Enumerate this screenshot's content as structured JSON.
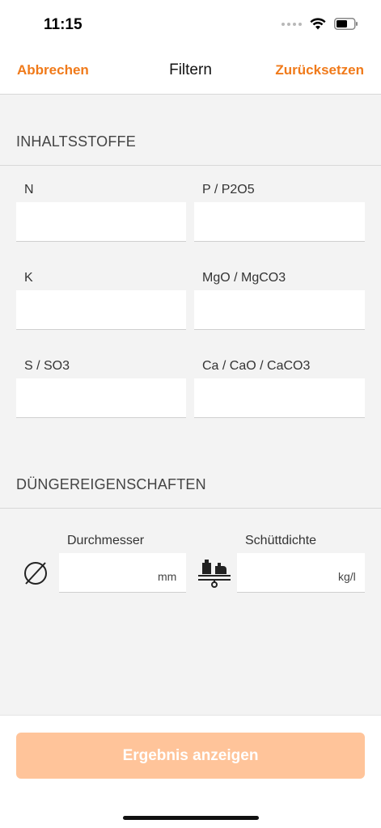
{
  "status_bar": {
    "time": "11:15"
  },
  "nav": {
    "cancel_label": "Abbrechen",
    "title": "Filtern",
    "reset_label": "Zurücksetzen",
    "accent_color": "#f07a1a"
  },
  "sections": {
    "ingredients_title": "INHALTSSTOFFE",
    "properties_title": "DÜNGEREIGENSCHAFTEN"
  },
  "ingredients": {
    "n_label": "N",
    "p_label": "P / P2O5",
    "k_label": "K",
    "mg_label": "MgO / MgCO3",
    "s_label": "S / SO3",
    "ca_label": "Ca / CaO / CaCO3"
  },
  "properties": {
    "diameter_label": "Durchmesser",
    "diameter_unit": "mm",
    "diameter_icon": "diameter-icon",
    "density_label": "Schüttdichte",
    "density_unit": "kg/l",
    "density_icon": "scale-icon"
  },
  "footer": {
    "result_button_label": "Ergebnis anzeigen",
    "button_color": "#ffc49a"
  }
}
